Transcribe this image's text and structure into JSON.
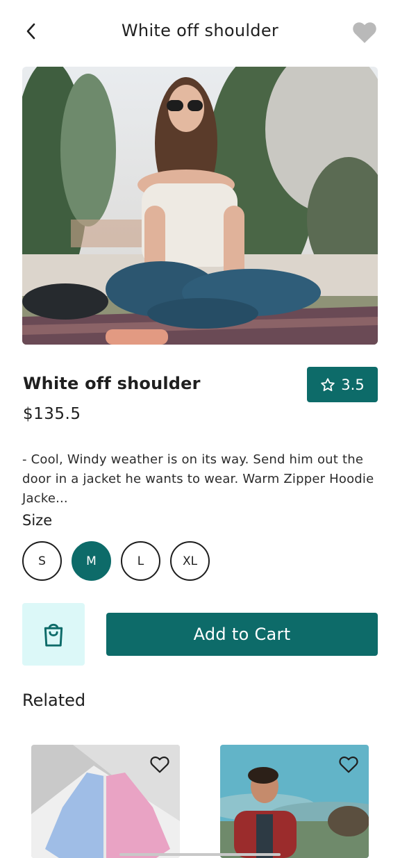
{
  "header": {
    "title": "White off shoulder"
  },
  "product": {
    "name": "White off shoulder",
    "price": "$135.5",
    "rating": "3.5",
    "description": "- Cool, Windy weather is on its way. Send him out the door in a jacket he wants to wear. Warm Zipper Hoodie Jacke..."
  },
  "size_section": {
    "label": "Size",
    "options": [
      "S",
      "M",
      "L",
      "XL"
    ],
    "selected": "M"
  },
  "actions": {
    "add_to_cart_label": "Add to Cart"
  },
  "related": {
    "label": "Related"
  },
  "colors": {
    "accent": "#0d6b69",
    "accent_light": "#dcf8f8",
    "heart_inactive": "#b9b9b9"
  },
  "icons": [
    "back-chevron-icon",
    "heart-icon",
    "star-icon",
    "shopping-bag-icon",
    "heart-outline-icon"
  ]
}
